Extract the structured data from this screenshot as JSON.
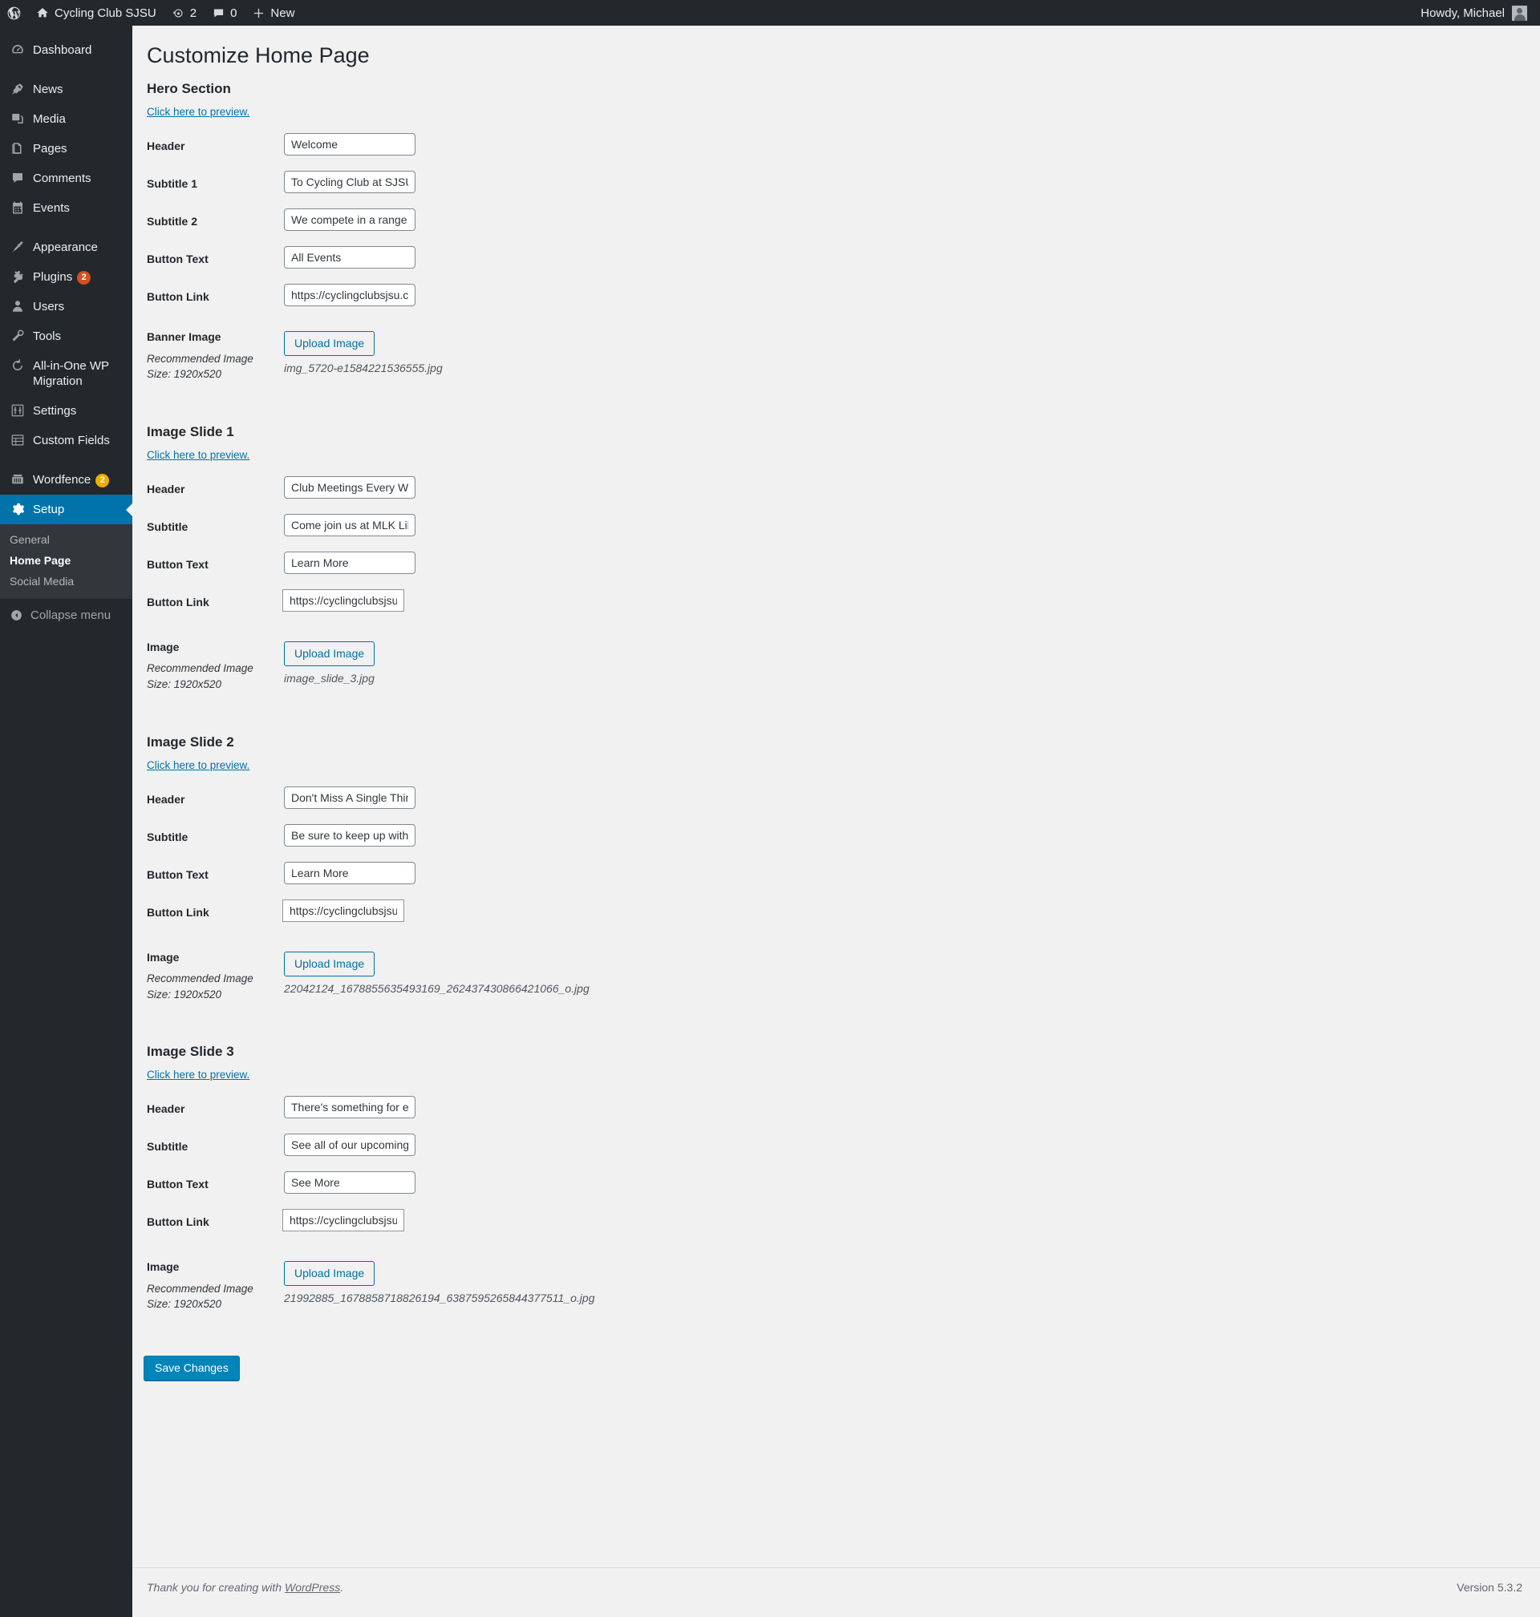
{
  "adminbar": {
    "logo_icon": "wordpress-logo-icon",
    "site_name": "Cycling Club SJSU",
    "site_icon": "home-icon",
    "updates_icon": "updates-icon",
    "updates_count": "2",
    "comments_icon": "comments-icon",
    "comments_count": "0",
    "new_icon": "plus-icon",
    "new_label": "New",
    "howdy": "Howdy, Michael",
    "avatar": "user-avatar"
  },
  "sidebar": {
    "items": [
      {
        "label": "Dashboard",
        "icon": "dashboard-icon",
        "badge": "",
        "sep_after": true
      },
      {
        "label": "News",
        "icon": "pin-icon",
        "badge": "",
        "sep_after": false
      },
      {
        "label": "Media",
        "icon": "media-icon",
        "badge": "",
        "sep_after": false
      },
      {
        "label": "Pages",
        "icon": "pages-icon",
        "badge": "",
        "sep_after": false
      },
      {
        "label": "Comments",
        "icon": "comments-icon",
        "badge": "",
        "sep_after": false
      },
      {
        "label": "Events",
        "icon": "calendar-icon",
        "badge": "",
        "sep_after": true
      },
      {
        "label": "Appearance",
        "icon": "appearance-icon",
        "badge": "",
        "sep_after": false
      },
      {
        "label": "Plugins",
        "icon": "plugins-icon",
        "badge": "2",
        "badge_color": "red",
        "sep_after": false
      },
      {
        "label": "Users",
        "icon": "users-icon",
        "badge": "",
        "sep_after": false
      },
      {
        "label": "Tools",
        "icon": "tools-icon",
        "badge": "",
        "sep_after": false
      },
      {
        "label": "All-in-One WP Migration",
        "icon": "migration-icon",
        "badge": "",
        "sep_after": false
      },
      {
        "label": "Settings",
        "icon": "settings-icon",
        "badge": "",
        "sep_after": false
      },
      {
        "label": "Custom Fields",
        "icon": "custom-fields-icon",
        "badge": "",
        "sep_after": true
      },
      {
        "label": "Wordfence",
        "icon": "wordfence-icon",
        "badge": "2",
        "badge_color": "orange",
        "sep_after": false
      },
      {
        "label": "Setup",
        "icon": "gear-icon",
        "badge": "",
        "current": true,
        "sep_after": false
      }
    ],
    "submenu": [
      {
        "label": "General",
        "current": false
      },
      {
        "label": "Home Page",
        "current": true
      },
      {
        "label": "Social Media",
        "current": false
      }
    ],
    "collapse_label": "Collapse menu",
    "collapse_icon": "collapse-arrow-icon",
    "accent_color": "#0073aa"
  },
  "main": {
    "page_title": "Customize Home Page",
    "preview_link_label": "Click here to preview.",
    "upload_button_label": "Upload Image",
    "recommended_label": "Recommended Image Size: 1920x520",
    "save_button_label": "Save Changes",
    "sections": [
      {
        "title": "Hero Section",
        "fields": [
          {
            "label": "Header",
            "value": "Welcome",
            "type": "text"
          },
          {
            "label": "Subtitle 1",
            "value": "To Cycling Club at SJSU",
            "type": "text"
          },
          {
            "label": "Subtitle 2",
            "value": "We compete in a range of",
            "type": "text"
          },
          {
            "label": "Button Text",
            "value": "All Events",
            "type": "text"
          },
          {
            "label": "Button Link",
            "value": "https://cyclingclubsjsu.com",
            "type": "text"
          }
        ],
        "image": {
          "label": "Banner Image",
          "filename": "img_5720-e1584221536555.jpg"
        }
      },
      {
        "title": "Image Slide 1",
        "fields": [
          {
            "label": "Header",
            "value": "Club Meetings Every Week",
            "type": "text"
          },
          {
            "label": "Subtitle",
            "value": "Come join us at MLK Library",
            "type": "text"
          },
          {
            "label": "Button Text",
            "value": "Learn More",
            "type": "text"
          },
          {
            "label": "Button Link",
            "value": "https://cyclingclubsjsu.com",
            "type": "url"
          }
        ],
        "image": {
          "label": "Image",
          "filename": "image_slide_3.jpg"
        }
      },
      {
        "title": "Image Slide 2",
        "fields": [
          {
            "label": "Header",
            "value": "Don't Miss A Single Thing",
            "type": "text"
          },
          {
            "label": "Subtitle",
            "value": "Be sure to keep up with",
            "type": "text"
          },
          {
            "label": "Button Text",
            "value": "Learn More",
            "type": "text"
          },
          {
            "label": "Button Link",
            "value": "https://cyclingclubsjsu.com",
            "type": "url"
          }
        ],
        "image": {
          "label": "Image",
          "filename": "22042124_1678855635493169_262437430866421066_o.jpg"
        }
      },
      {
        "title": "Image Slide 3",
        "fields": [
          {
            "label": "Header",
            "value": "There's something for everyone",
            "type": "text"
          },
          {
            "label": "Subtitle",
            "value": "See all of our upcoming",
            "type": "text"
          },
          {
            "label": "Button Text",
            "value": "See More",
            "type": "text"
          },
          {
            "label": "Button Link",
            "value": "https://cyclingclubsjsu.com",
            "type": "url"
          }
        ],
        "image": {
          "label": "Image",
          "filename": "21992885_1678858718826194_6387595265844377511_o.jpg"
        }
      }
    ]
  },
  "footer": {
    "thanks_prefix": "Thank you for creating with ",
    "wordpress_link": "WordPress",
    "thanks_suffix": ".",
    "version": "Version 5.3.2"
  }
}
